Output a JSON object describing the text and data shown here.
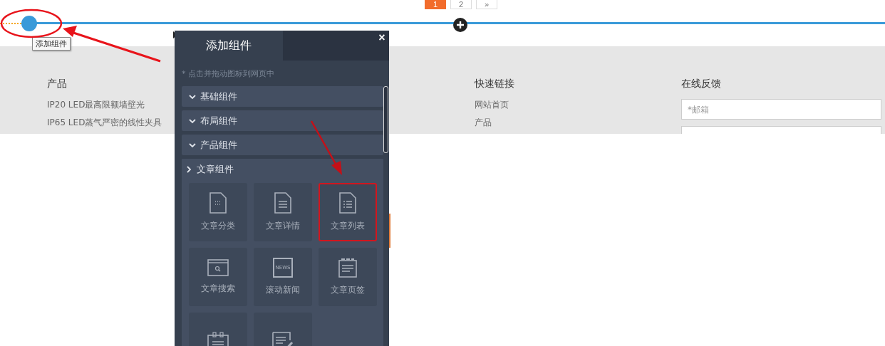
{
  "pagination": [
    {
      "label": "1",
      "selected": true
    },
    {
      "label": "2",
      "selected": false
    },
    {
      "label": "»",
      "selected": false
    }
  ],
  "tooltip": "添加组件",
  "footer": {
    "columns": [
      {
        "title": "产品",
        "links": [
          "IP20 LED最高限额墙壁光",
          "IP65 LED蒸气严密的线性夹具"
        ]
      },
      {
        "title": "快速链接",
        "links": [
          "网站首页",
          "产品"
        ]
      }
    ],
    "feedback": {
      "title": "在线反馈",
      "placeholder": "*邮箱"
    }
  },
  "panel": {
    "tabs": [
      {
        "label": "添加组件",
        "selected": true
      }
    ],
    "close": "×",
    "hint": "* 点击并拖动图标到网页中",
    "sections": [
      {
        "label": "基础组件",
        "expanded": false
      },
      {
        "label": "布局组件",
        "expanded": false
      },
      {
        "label": "产品组件",
        "expanded": false
      },
      {
        "label": "文章组件",
        "expanded": true,
        "tiles": [
          {
            "kind": "category",
            "label": "文章分类",
            "highlighted": false
          },
          {
            "kind": "detail",
            "label": "文章详情",
            "highlighted": false
          },
          {
            "kind": "list",
            "label": "文章列表",
            "highlighted": true
          },
          {
            "kind": "search",
            "label": "文章搜索",
            "highlighted": false
          },
          {
            "kind": "news",
            "label": "滚动新闻",
            "icon_text": "NEWS",
            "highlighted": false
          },
          {
            "kind": "tabs",
            "label": "文章页签",
            "highlighted": false
          },
          {
            "kind": "calendar",
            "highlighted": false
          },
          {
            "kind": "edit",
            "highlighted": false
          }
        ]
      }
    ]
  }
}
